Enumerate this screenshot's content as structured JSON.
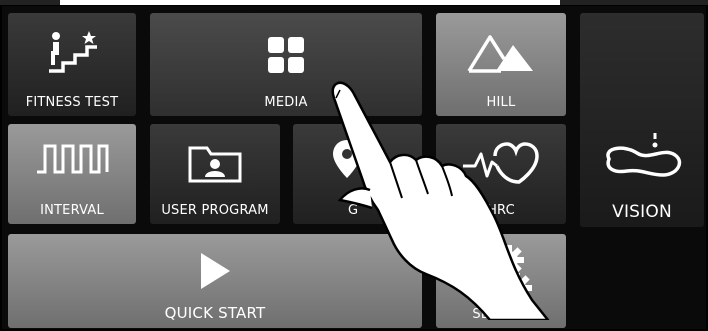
{
  "tiles": {
    "fitness_test": "FITNESS TEST",
    "media": "MEDIA",
    "hill": "HILL",
    "interval": "INTERVAL",
    "user_program": "USER PROGRAM",
    "gps": "G",
    "hrc": "HRC",
    "vision": "VISION",
    "quick_start": "QUICK START",
    "setting": "SETTING"
  }
}
